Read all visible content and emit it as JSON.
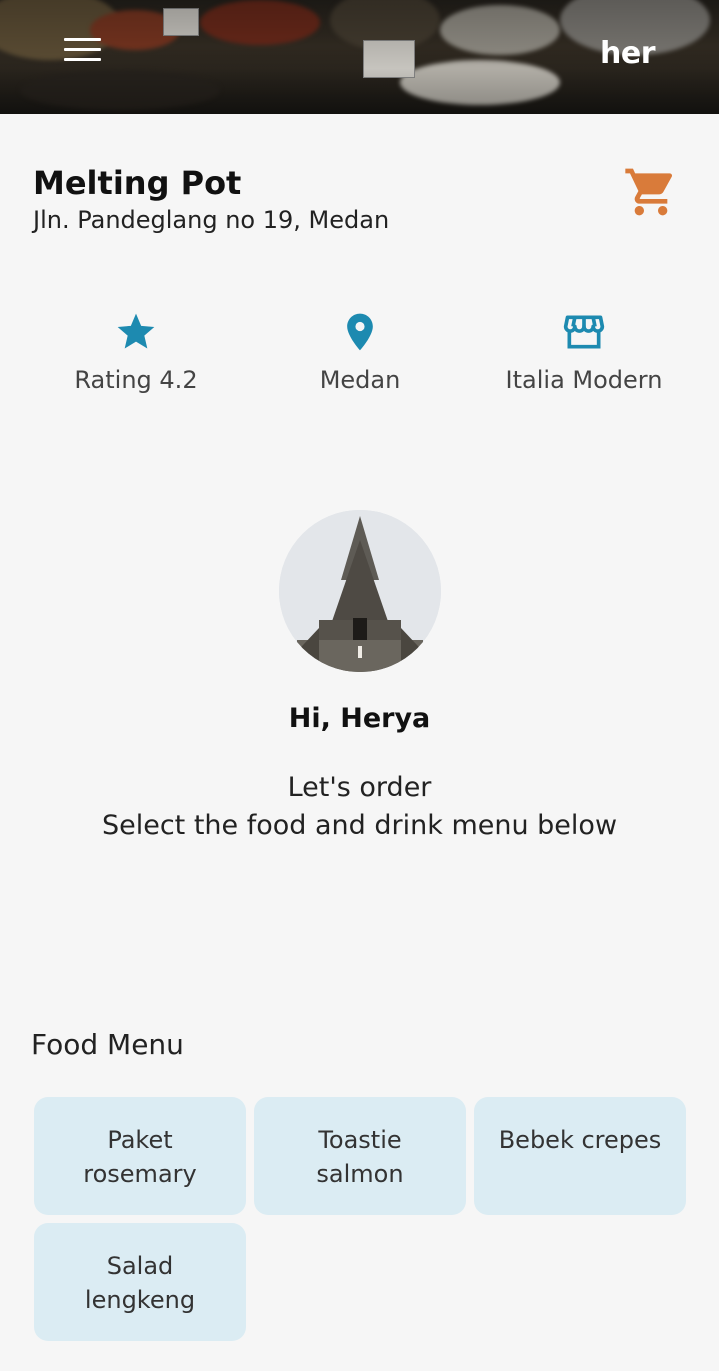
{
  "header": {
    "brand": "her",
    "menu_icon": "hamburger-menu-icon"
  },
  "restaurant": {
    "name": "Melting Pot",
    "address": "Jln. Pandeglang no 19, Medan",
    "cart_icon": "shopping-cart-icon",
    "cart_color": "#d97b3a"
  },
  "stats": [
    {
      "icon": "star-icon",
      "label": "Rating 4.2"
    },
    {
      "icon": "location-pin-icon",
      "label": "Medan"
    },
    {
      "icon": "store-icon",
      "label": "Italia Modern"
    }
  ],
  "accent_color": "#1d8ab0",
  "greeting": {
    "hello": "Hi, Herya",
    "line1": "Let's order",
    "line2": "Select the food and drink menu below"
  },
  "food_menu": {
    "title": "Food Menu",
    "items": [
      "Paket rosemary",
      "Toastie salmon",
      "Bebek crepes",
      "Salad lengkeng"
    ]
  }
}
